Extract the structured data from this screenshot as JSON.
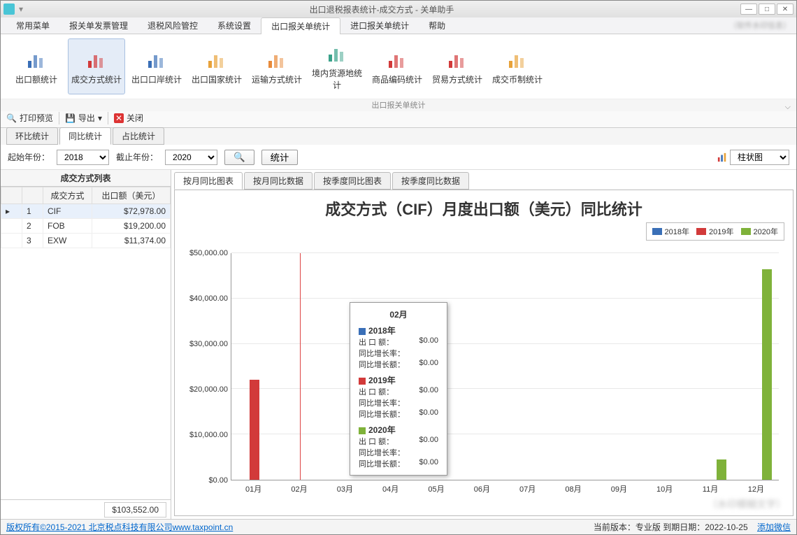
{
  "titlebar": {
    "title": "出口退税报表统计-成交方式 - 关单助手",
    "watermark": "（软件水印信息）"
  },
  "menubar": {
    "items": [
      "常用菜单",
      "报关单发票管理",
      "退税风险管控",
      "系统设置",
      "出口报关单统计",
      "进口报关单统计",
      "帮助"
    ],
    "active_index": 4
  },
  "ribbon": {
    "items": [
      "出口额统计",
      "成交方式统计",
      "出口口岸统计",
      "出口国家统计",
      "运输方式统计",
      "境内货源地统计",
      "商品编码统计",
      "贸易方式统计",
      "成交币制统计"
    ],
    "active_index": 1,
    "footer": "出口报关单统计"
  },
  "toolbar2": {
    "preview": "打印预览",
    "export": "导出",
    "close": "关闭"
  },
  "stat_tabs": {
    "items": [
      "环比统计",
      "同比统计",
      "占比统计"
    ],
    "active_index": 1
  },
  "filter": {
    "start_label": "起始年份：",
    "start_value": "2018",
    "end_label": "截止年份：",
    "end_value": "2020",
    "stat_btn": "统计",
    "chart_type": "柱状图"
  },
  "side": {
    "title": "成交方式列表",
    "col_idx": "",
    "col_type": "成交方式",
    "col_amount": "出口额（美元）",
    "rows": [
      {
        "idx": "1",
        "type": "CIF",
        "amount": "$72,978.00",
        "sel": true
      },
      {
        "idx": "2",
        "type": "FOB",
        "amount": "$19,200.00",
        "sel": false
      },
      {
        "idx": "3",
        "type": "EXW",
        "amount": "$11,374.00",
        "sel": false
      }
    ],
    "total": "$103,552.00"
  },
  "chart_tabs": {
    "items": [
      "按月同比图表",
      "按月同比数据",
      "按季度同比图表",
      "按季度同比数据"
    ],
    "active_index": 0
  },
  "chart_title": "成交方式（CIF）月度出口额（美元）同比统计",
  "legend": {
    "y2018": "2018年",
    "y2019": "2019年",
    "y2020": "2020年"
  },
  "colors": {
    "c2018": "#3a6fb7",
    "c2019": "#d23a3a",
    "c2020": "#7fb23a"
  },
  "tooltip": {
    "title": "02月",
    "y2018": {
      "label": "2018年",
      "l1k": "出 口 额：",
      "l1v": "$0.00",
      "l2k": "同比增长率：",
      "l2v": "",
      "l3k": "同比增长额：",
      "l3v": "$0.00"
    },
    "y2019": {
      "label": "2019年",
      "l1k": "出 口 额：",
      "l1v": "$0.00",
      "l2k": "同比增长率：",
      "l2v": "",
      "l3k": "同比增长额：",
      "l3v": "$0.00"
    },
    "y2020": {
      "label": "2020年",
      "l1k": "出 口 额：",
      "l1v": "$0.00",
      "l2k": "同比增长率：",
      "l2v": "",
      "l3k": "同比增长额：",
      "l3v": "$0.00"
    }
  },
  "statusbar": {
    "copyright": "版权所有©2015-2021 北京税点科技有限公司www.taxpoint.cn",
    "version": "当前版本：专业版  到期日期：2022-10-25",
    "wechat": "添加微信"
  },
  "chart_data": {
    "type": "bar",
    "title": "成交方式（CIF）月度出口额（美元）同比统计",
    "categories": [
      "01月",
      "02月",
      "03月",
      "04月",
      "05月",
      "06月",
      "07月",
      "08月",
      "09月",
      "10月",
      "11月",
      "12月"
    ],
    "series": [
      {
        "name": "2018年",
        "values": [
          0,
          0,
          0,
          0,
          0,
          0,
          0,
          0,
          0,
          0,
          0,
          0
        ]
      },
      {
        "name": "2019年",
        "values": [
          22000,
          0,
          0,
          0,
          0,
          0,
          0,
          0,
          0,
          0,
          0,
          0
        ]
      },
      {
        "name": "2020年",
        "values": [
          0,
          0,
          0,
          0,
          0,
          0,
          0,
          0,
          0,
          0,
          4500,
          46500
        ]
      }
    ],
    "ylim": [
      0,
      50000
    ],
    "yticks": [
      "$0.00",
      "$10,000.00",
      "$20,000.00",
      "$30,000.00",
      "$40,000.00",
      "$50,000.00"
    ],
    "ylabel": "",
    "xlabel": ""
  }
}
